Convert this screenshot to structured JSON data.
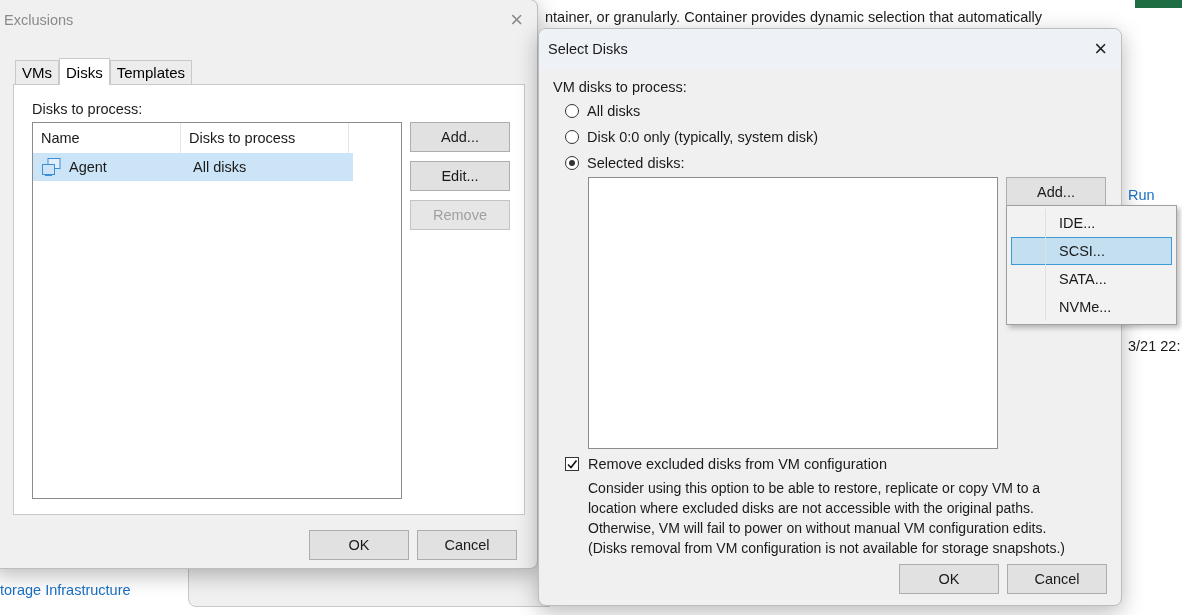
{
  "background": {
    "description_fragment": "ntainer, or granularly. Container provides dynamic selection that automatically",
    "side_texts": [
      "Run",
      "3/21 22:"
    ],
    "link": "torage Infrastructure"
  },
  "exclusions_window": {
    "title": "Exclusions",
    "close": "×",
    "tabs": [
      {
        "label": "VMs",
        "selected": false
      },
      {
        "label": "Disks",
        "selected": true
      },
      {
        "label": "Templates",
        "selected": false
      }
    ],
    "list_label": "Disks to process:",
    "table": {
      "columns": [
        "Name",
        "Disks to process"
      ],
      "rows": [
        {
          "name": "Agent",
          "disks": "All disks",
          "selected": true
        }
      ]
    },
    "side_buttons": [
      {
        "label": "Add...",
        "disabled": false
      },
      {
        "label": "Edit...",
        "disabled": false
      },
      {
        "label": "Remove",
        "disabled": true
      }
    ],
    "buttons": [
      "OK",
      "Cancel"
    ]
  },
  "select_disks_window": {
    "title": "Select Disks",
    "close": "×",
    "group_label": "VM disks to process:",
    "options": [
      {
        "label": "All disks",
        "selected": false
      },
      {
        "label": "Disk 0:0 only (typically, system disk)",
        "selected": false
      },
      {
        "label": "Selected disks:",
        "selected": true
      }
    ],
    "add_button": "Add...",
    "add_menu": [
      {
        "label": "IDE...",
        "selected": false
      },
      {
        "label": "SCSI...",
        "selected": true
      },
      {
        "label": "SATA...",
        "selected": false
      },
      {
        "label": "NVMe...",
        "selected": false
      }
    ],
    "remove_option": {
      "label": "Remove excluded disks from VM configuration",
      "checked": true
    },
    "description": [
      "Consider using this option to be able to restore, replicate or copy VM to a",
      "location where excluded disks are not accessible with the original paths.",
      "Otherwise, VM will fail to power on without manual VM configuration edits.",
      "(Disks removal from VM configuration is not available for storage snapshots.)"
    ],
    "buttons": [
      "OK",
      "Cancel"
    ]
  }
}
